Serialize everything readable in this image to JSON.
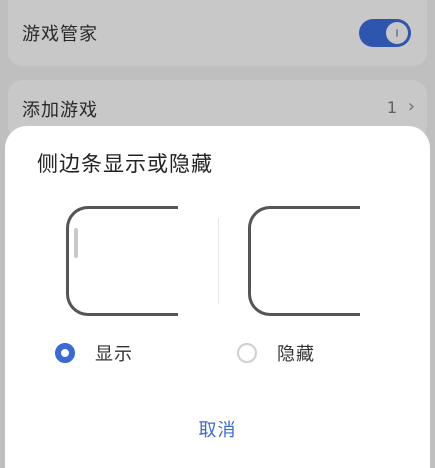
{
  "background": {
    "game_manager_label": "游戏管家",
    "game_manager_enabled": true,
    "add_game_label": "添加游戏",
    "add_game_count": "1",
    "chevron": "chevron-right-icon"
  },
  "dialog": {
    "title": "侧边条显示或隐藏",
    "options": [
      {
        "label": "显示",
        "selected": true
      },
      {
        "label": "隐藏",
        "selected": false
      }
    ],
    "cancel_label": "取消"
  },
  "colors": {
    "accent": "#3a6ad6",
    "radio_unchecked": "#cfcfcf",
    "frame": "#555555"
  }
}
